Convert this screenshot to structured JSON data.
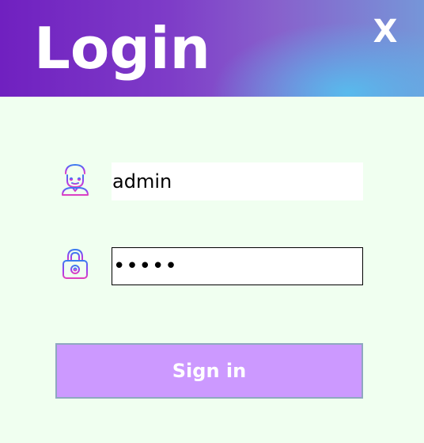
{
  "header": {
    "title": "Login",
    "close_label": "X"
  },
  "form": {
    "username_value": "admin",
    "password_value": "admin",
    "signin_label": "Sign in"
  },
  "icons": {
    "username": "user-icon",
    "password": "lock-icon"
  },
  "colors": {
    "background": "#f0fff0",
    "header_gradient_start": "#7020c0",
    "header_gradient_end": "#56beee",
    "button_fill": "#cc99ff",
    "button_border": "#8ea8c0",
    "icon_stroke_primary": "#9a3ff0",
    "icon_stroke_secondary": "#e040c0"
  }
}
